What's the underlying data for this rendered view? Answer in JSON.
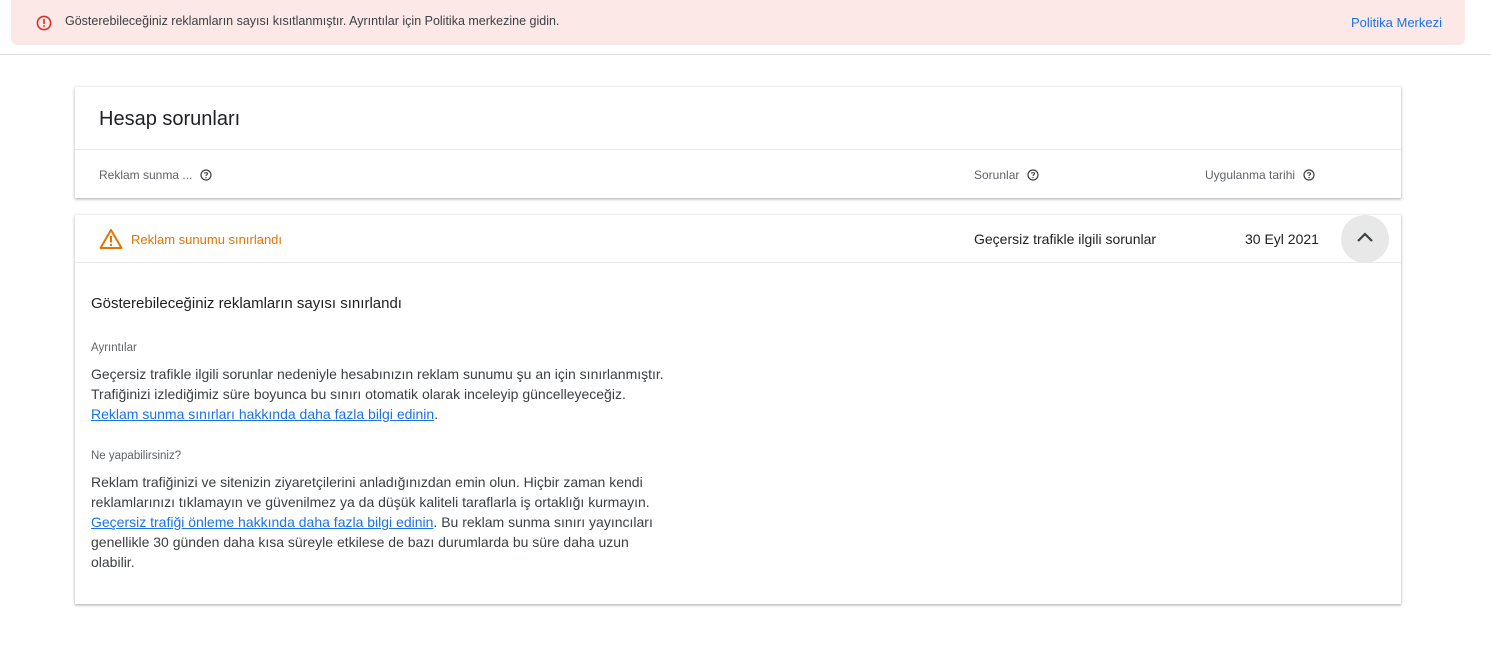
{
  "banner": {
    "message": "Gösterebileceğiniz reklamların sayısı kısıtlanmıştır. Ayrıntılar için Politika merkezine gidin.",
    "link_label": "Politika Merkezi",
    "icon": "error-circle-icon",
    "background_color": "#fce8e6",
    "icon_color": "#d93025",
    "link_color": "#1a73e8"
  },
  "account_issues": {
    "title": "Hesap sorunları",
    "columns": [
      {
        "label": "Reklam sunma ...",
        "help_icon": "help-circle-icon"
      },
      {
        "label": "Sorunlar",
        "help_icon": "help-circle-icon"
      },
      {
        "label": "Uygulanma tarihi",
        "help_icon": "help-circle-icon"
      }
    ]
  },
  "issue": {
    "status": "Reklam sunumu sınırlandı",
    "status_icon": "warning-triangle-icon",
    "status_color": "#e37400",
    "problem": "Geçersiz trafikle ilgili sorunlar",
    "date": "30 Eyl 2021",
    "toggle_icon": "chevron-up-icon",
    "detail": {
      "title": "Gösterebileceğiniz reklamların sayısı sınırlandı",
      "details_label": "Ayrıntılar",
      "details_text_before": "Geçersiz trafikle ilgili sorunlar nedeniyle hesabınızın reklam sunumu şu an için sınırlanmıştır. Trafiğinizi izlediğimiz süre boyunca bu sınırı otomatik olarak inceleyip güncelleyeceğiz. ",
      "details_link": "Reklam sunma sınırları hakkında daha fazla bilgi edinin",
      "details_text_after": ".",
      "what_label": "Ne yapabilirsiniz?",
      "what_text_before": "Reklam trafiğinizi ve sitenizin ziyaretçilerini anladığınızdan emin olun. Hiçbir zaman kendi reklamlarınızı tıklamayın ve güvenilmez ya da düşük kaliteli taraflarla iş ortaklığı kurmayın. ",
      "what_link": "Geçersiz trafiği önleme hakkında daha fazla bilgi edinin",
      "what_text_after": ". Bu reklam sunma sınırı yayıncıları genellikle 30 günden daha kısa süreyle etkilese de bazı durumlarda bu süre daha uzun olabilir."
    }
  }
}
